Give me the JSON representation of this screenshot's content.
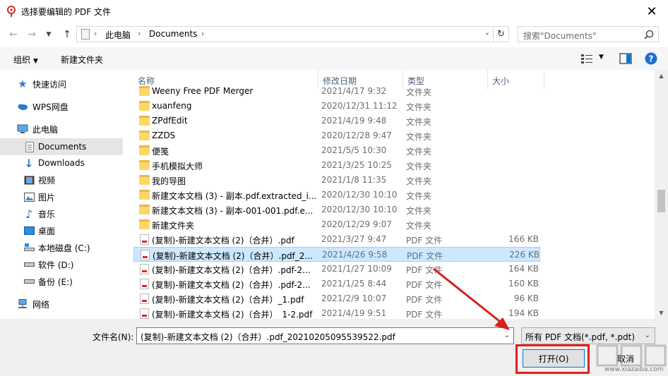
{
  "window": {
    "title": "选择要编辑的 PDF 文件",
    "close_glyph": "✕"
  },
  "address": {
    "segments": [
      "此电脑",
      "Documents"
    ],
    "search_placeholder": "搜索\"Documents\""
  },
  "toolbar": {
    "organize_label": "组织",
    "new_folder_label": "新建文件夹"
  },
  "nav_pane": {
    "items": [
      {
        "label": "快速访问",
        "icon": "star-icon"
      },
      {
        "label": "WPS网盘",
        "icon": "cloud-icon"
      },
      {
        "label": "此电脑",
        "icon": "computer-icon"
      },
      {
        "label": "Documents",
        "icon": "document-icon",
        "selected": true
      },
      {
        "label": "Downloads",
        "icon": "download-icon"
      },
      {
        "label": "视频",
        "icon": "video-icon"
      },
      {
        "label": "图片",
        "icon": "picture-icon"
      },
      {
        "label": "音乐",
        "icon": "music-icon"
      },
      {
        "label": "桌面",
        "icon": "desktop-icon"
      },
      {
        "label": "本地磁盘 (C:)",
        "icon": "drive-icon"
      },
      {
        "label": "软件 (D:)",
        "icon": "drive-icon"
      },
      {
        "label": "备份 (E:)",
        "icon": "drive-icon"
      },
      {
        "label": "网络",
        "icon": "network-icon"
      }
    ]
  },
  "file_list": {
    "columns": {
      "name": "名称",
      "date": "修改日期",
      "type": "类型",
      "size": "大小"
    },
    "rows": [
      {
        "name": "Weeny Free PDF Merger",
        "date": "2021/4/17 9:32",
        "type": "文件夹",
        "size": "",
        "kind": "folder"
      },
      {
        "name": "xuanfeng",
        "date": "2020/12/31 11:12",
        "type": "文件夹",
        "size": "",
        "kind": "folder"
      },
      {
        "name": "ZPdfEdit",
        "date": "2021/4/19 9:48",
        "type": "文件夹",
        "size": "",
        "kind": "folder"
      },
      {
        "name": "ZZDS",
        "date": "2020/12/28 9:47",
        "type": "文件夹",
        "size": "",
        "kind": "folder"
      },
      {
        "name": "便笺",
        "date": "2021/5/5 10:30",
        "type": "文件夹",
        "size": "",
        "kind": "folder"
      },
      {
        "name": "手机模拟大师",
        "date": "2021/3/25 10:25",
        "type": "文件夹",
        "size": "",
        "kind": "folder"
      },
      {
        "name": "我的导图",
        "date": "2021/1/8 11:35",
        "type": "文件夹",
        "size": "",
        "kind": "folder"
      },
      {
        "name": "新建文本文档 (3) - 副本.pdf.extracted_i...",
        "date": "2020/12/30 10:10",
        "type": "文件夹",
        "size": "",
        "kind": "folder"
      },
      {
        "name": "新建文本文档 (3) - 副本-001-001.pdf.e...",
        "date": "2020/12/30 10:10",
        "type": "文件夹",
        "size": "",
        "kind": "folder"
      },
      {
        "name": "新建文件夹",
        "date": "2020/12/29 9:07",
        "type": "文件夹",
        "size": "",
        "kind": "folder"
      },
      {
        "name": "(复制)-新建文本文档 (2)（合并）.pdf",
        "date": "2021/3/27 9:47",
        "type": "PDF 文件",
        "size": "166 KB",
        "kind": "pdf"
      },
      {
        "name": "(复制)-新建文本文档 (2)（合并）.pdf_2...",
        "date": "2021/4/26 9:58",
        "type": "PDF 文件",
        "size": "226 KB",
        "kind": "pdf",
        "selected": true
      },
      {
        "name": "(复制)-新建文本文档 (2)（合并）.pdf-2...",
        "date": "2021/1/27 10:09",
        "type": "PDF 文件",
        "size": "164 KB",
        "kind": "pdf"
      },
      {
        "name": "(复制)-新建文本文档 (2)（合并）.pdf-2...",
        "date": "2021/1/25 8:44",
        "type": "PDF 文件",
        "size": "160 KB",
        "kind": "pdf"
      },
      {
        "name": "(复制)-新建文本文档 (2)（合并）_1.pdf",
        "date": "2021/2/9 10:07",
        "type": "PDF 文件",
        "size": "96 KB",
        "kind": "pdf"
      },
      {
        "name": "(复制)-新建文本文档 (2)（合并）_1-2.pdf",
        "date": "2021/4/19 9:51",
        "type": "PDF 文件",
        "size": "194 KB",
        "kind": "pdf"
      }
    ]
  },
  "bottom": {
    "filename_label": "文件名(N):",
    "filename_value": "(复制)-新建文本文档 (2)（合并）.pdf_20210205095539522.pdf",
    "filter_value": "所有 PDF 文档(*.pdf, *.pdt)",
    "open_label": "打开(O)",
    "cancel_label": "取消",
    "watermark_url": "www.xiazaiba.com"
  },
  "colors": {
    "selection": "#cce8ff",
    "highlight_red": "#e0201c",
    "accent_blue": "#0078d7"
  }
}
